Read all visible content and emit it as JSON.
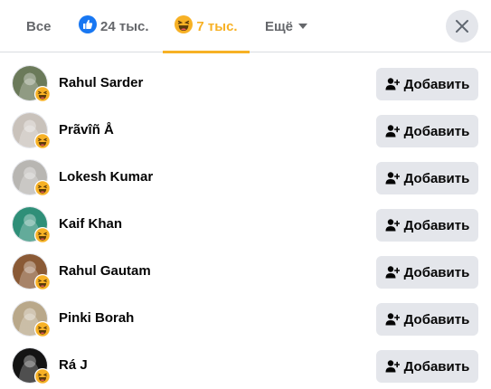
{
  "tabs": {
    "all_label": "Все",
    "like_count": "24 тыс.",
    "haha_count": "7 тыс.",
    "more_label": "Ещё"
  },
  "colors": {
    "active_tab": "#f7b125",
    "like_blue": "#1877f2",
    "button_bg": "#e4e6eb"
  },
  "people": [
    {
      "name": "Rahul Sarder",
      "button": "Добавить",
      "avatar_color": "#6b7a5a"
    },
    {
      "name": "Prãvîñ Å",
      "button": "Добавить",
      "avatar_color": "#c9c2bb"
    },
    {
      "name": "Lokesh Kumar",
      "button": "Добавить",
      "avatar_color": "#b8b6b2"
    },
    {
      "name": "Kaif Khan",
      "button": "Добавить",
      "avatar_color": "#2f8f78"
    },
    {
      "name": "Rahul Gautam",
      "button": "Добавить",
      "avatar_color": "#8a5a36"
    },
    {
      "name": "Pinki Borah",
      "button": "Добавить",
      "avatar_color": "#b9a88a"
    },
    {
      "name": "Rá J",
      "button": "Добавить",
      "avatar_color": "#141414"
    }
  ]
}
